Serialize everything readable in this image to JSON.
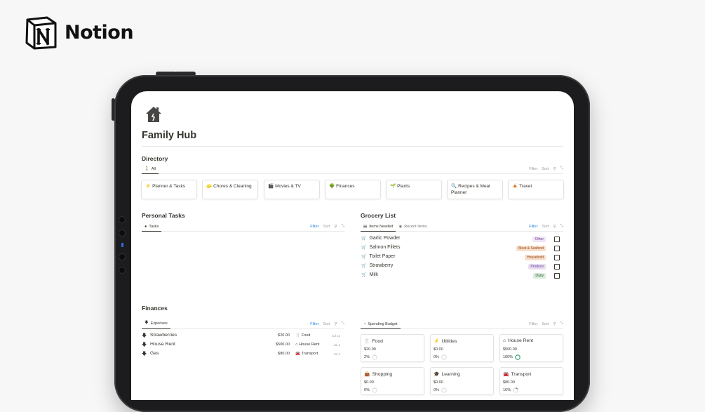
{
  "brand": {
    "name": "Notion"
  },
  "page": {
    "title": "Family Hub"
  },
  "directory": {
    "title": "Directory",
    "tab": "All",
    "tools": {
      "filter": "Filter",
      "sort": "Sort"
    },
    "items": [
      {
        "emoji": "⚡",
        "label": "Planner & Tasks"
      },
      {
        "emoji": "🧽",
        "label": "Chores & Cleaning"
      },
      {
        "emoji": "🎬",
        "label": "Movies & TV"
      },
      {
        "emoji": "🌳",
        "label": "Finances"
      },
      {
        "emoji": "🌱",
        "label": "Plants"
      },
      {
        "emoji": "🔍",
        "label": "Recipes & Meal Planner"
      },
      {
        "emoji": "🍝",
        "label": "Travel"
      }
    ]
  },
  "personal_tasks": {
    "title": "Personal Tasks",
    "tab": "Tasks",
    "tools": {
      "filter": "Filter",
      "sort": "Sort"
    }
  },
  "grocery": {
    "title": "Grocery List",
    "tabs": [
      "Items Needed",
      "Recent Items"
    ],
    "tools": {
      "filter": "Filter",
      "sort": "Sort"
    },
    "items": [
      {
        "name": "Garlic Powder",
        "tag": "Other",
        "tag_bg": "#f1e5f7",
        "tag_fg": "#6c3a85",
        "checked": false
      },
      {
        "name": "Salmon Fillets",
        "tag": "Meat & Seafood",
        "tag_bg": "#fadec9",
        "tag_fg": "#8a4a1e",
        "checked": false
      },
      {
        "name": "Toilet Paper",
        "tag": "Household",
        "tag_bg": "#fadec9",
        "tag_fg": "#8a4a1e",
        "checked": false
      },
      {
        "name": "Strawberry",
        "tag": "Produce",
        "tag_bg": "#e8deee",
        "tag_fg": "#6940a5",
        "checked": false
      },
      {
        "name": "Milk",
        "tag": "Dairy",
        "tag_bg": "#dbeddb",
        "tag_fg": "#2b593f",
        "checked": false
      }
    ]
  },
  "finances": {
    "title": "Finances",
    "tab": "Expenses",
    "tools": {
      "filter": "Filter",
      "sort": "Sort"
    },
    "expenses": [
      {
        "name": "Strawberries",
        "amount": "$20.00",
        "category": "Food",
        "category_icon": "fork-knife-icon",
        "date": "Jul 12"
      },
      {
        "name": "House Rent",
        "amount": "$500.00",
        "category": "House Rent",
        "category_icon": "house-icon",
        "date": "Jul 1"
      },
      {
        "name": "Gas",
        "amount": "$80.00",
        "category": "Transport",
        "category_icon": "car-icon",
        "date": "Jul 4"
      }
    ]
  },
  "budget": {
    "tab": "Spending Budget",
    "tools": {
      "filter": "Filter",
      "sort": "Sort"
    },
    "cards": [
      {
        "name": "Food",
        "icon": "fork-knife-icon",
        "amount": "$20.00",
        "percent": "2%",
        "progress": 0.02
      },
      {
        "name": "Utilities",
        "icon": "bolt-icon",
        "amount": "$0.00",
        "percent": "0%",
        "progress": 0
      },
      {
        "name": "House Rent",
        "icon": "house-icon",
        "amount": "$500.00",
        "percent": "100%",
        "progress": 1
      },
      {
        "name": "Shopping",
        "icon": "bag-icon",
        "amount": "$0.00",
        "percent": "0%",
        "progress": 0
      },
      {
        "name": "Learning",
        "icon": "graduation-icon",
        "amount": "$0.00",
        "percent": "0%",
        "progress": 0
      },
      {
        "name": "Transport",
        "icon": "car-icon",
        "amount": "$80.00",
        "percent": "16%",
        "progress": 0.16
      }
    ]
  },
  "colors": {
    "accent_blue": "#2383e2",
    "ring_green": "#2f9e6a",
    "text": "#37352f"
  }
}
